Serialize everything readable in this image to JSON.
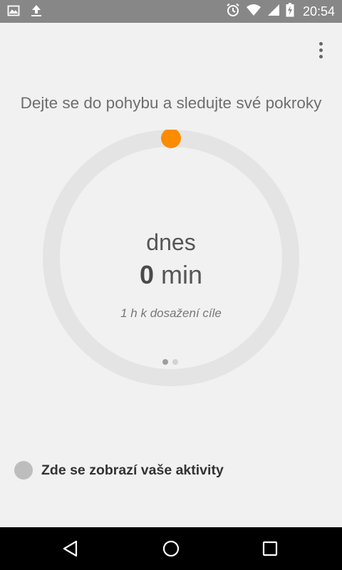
{
  "status_bar": {
    "icons_left": [
      "image-icon",
      "upload-icon"
    ],
    "icons_right": [
      "alarm-icon",
      "wifi-icon",
      "signal-icon",
      "battery-charging-icon"
    ],
    "time": "20:54"
  },
  "app": {
    "headline": "Dejte se do pohybu a sledujte své pokroky",
    "today_label": "dnes",
    "minutes_value": "0",
    "minutes_unit": "min",
    "goal_text": "1 h k dosažení cíle",
    "progress": 0,
    "pager": {
      "count": 2,
      "active": 0
    },
    "activity_placeholder": "Zde se zobrazí vaše aktivity"
  },
  "colors": {
    "accent": "#FB8C00",
    "ring_track": "#e4e4e4",
    "status_bar": "#878787",
    "nav_bar": "#000000"
  },
  "nav_bar": {
    "buttons": [
      "back-icon",
      "home-icon",
      "recents-icon"
    ]
  }
}
